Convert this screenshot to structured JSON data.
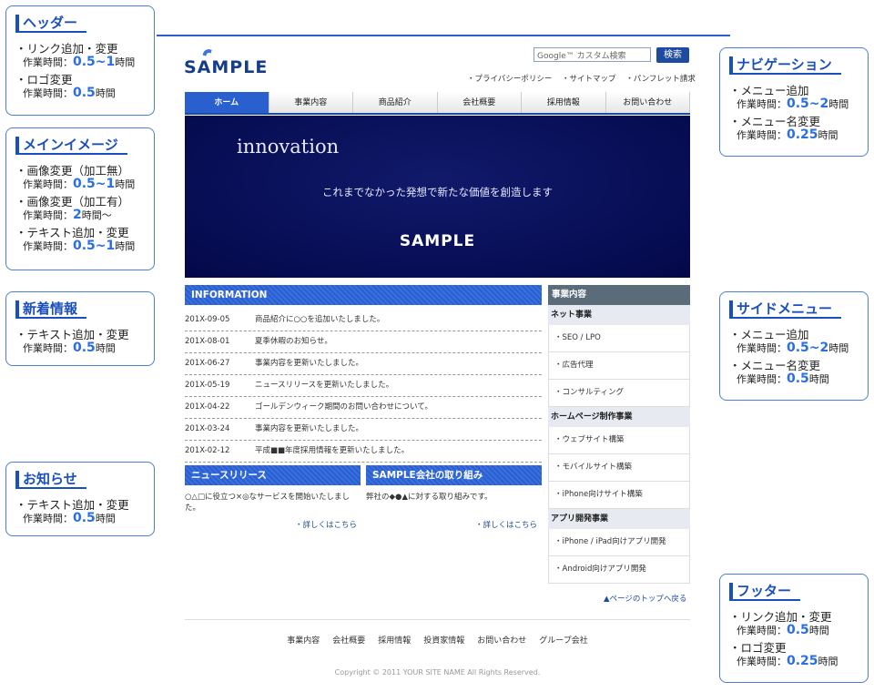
{
  "site": {
    "logo": "SAMPLE",
    "search_placeholder": "Google™ カスタム検索",
    "search_button": "検索",
    "top_links": [
      "・プライバシーポリシー",
      "・サイトマップ",
      "・パンフレット請求"
    ],
    "nav": [
      "ホーム",
      "事業内容",
      "商品紹介",
      "会社概要",
      "採用情報",
      "お問い合わせ"
    ],
    "hero": {
      "title": "innovation",
      "subtitle": "これまでなかった発想で新たな価値を創造します",
      "logo": "SAMPLE"
    },
    "info_title": "INFORMATION",
    "info": [
      {
        "date": "201X-09-05",
        "text": "商品紹介に○○を追加いたしました。"
      },
      {
        "date": "201X-08-01",
        "text": "夏季休暇のお知らせ。"
      },
      {
        "date": "201X-06-27",
        "text": "事業内容を更新いたしました。"
      },
      {
        "date": "201X-05-19",
        "text": "ニュースリリースを更新いたしました。"
      },
      {
        "date": "201X-04-22",
        "text": "ゴールデンウィーク期間のお問い合わせについて。"
      },
      {
        "date": "201X-03-24",
        "text": "事業内容を更新いたしました。"
      },
      {
        "date": "201X-02-12",
        "text": "平成■■年度採用情報を更新いたしました。"
      }
    ],
    "news_title": "ニュースリリース",
    "news_text": "○△□に役立つ×◎なサービスを開始いたしました。",
    "news_more": "・詳しくはこちら",
    "csr_title": "SAMPLE会社の取り組み",
    "csr_text": "弊社の◆●▲に対する取り組みです。",
    "csr_more": "・詳しくはこちら",
    "side_title": "事業内容",
    "side": [
      {
        "cat": "ネット事業",
        "items": [
          "・SEO / LPO",
          "・広告代理",
          "・コンサルティング"
        ]
      },
      {
        "cat": "ホームページ制作事業",
        "items": [
          "・ウェブサイト構築",
          "・モバイルサイト構築",
          "・iPhone向けサイト構築"
        ]
      },
      {
        "cat": "アプリ開発事業",
        "items": [
          "・iPhone / iPad向けアプリ開発",
          "・Android向けアプリ開発"
        ]
      }
    ],
    "page_top": "▲ページのトップへ戻る",
    "footer_links": [
      "事業内容",
      "会社概要",
      "採用情報",
      "投資家情報",
      "お問い合わせ",
      "グループ会社"
    ],
    "copyright": "Copyright © 2011 YOUR SITE NAME All Rights Reserved."
  },
  "callouts": {
    "header": {
      "title": "ヘッダー",
      "items": [
        {
          "label": "・リンク追加・変更",
          "prefix": "作業時間：",
          "value": "0.5~1",
          "suffix": "時間"
        },
        {
          "label": "・ロゴ変更",
          "prefix": "作業時間：",
          "value": "0.5",
          "suffix": "時間"
        }
      ]
    },
    "mainimage": {
      "title": "メインイメージ",
      "items": [
        {
          "label": "・画像変更（加工無）",
          "prefix": "作業時間：",
          "value": "0.5~1",
          "suffix": "時間"
        },
        {
          "label": "・画像変更（加工有）",
          "prefix": "作業時間：",
          "value": "2",
          "suffix": "時間～"
        },
        {
          "label": "・テキスト追加・変更",
          "prefix": "作業時間：",
          "value": "0.5~1",
          "suffix": "時間"
        }
      ]
    },
    "news": {
      "title": "新着情報",
      "items": [
        {
          "label": "・テキスト追加・変更",
          "prefix": "作業時間：",
          "value": "0.5",
          "suffix": "時間"
        }
      ]
    },
    "notice": {
      "title": "お知らせ",
      "items": [
        {
          "label": "・テキスト追加・変更",
          "prefix": "作業時間：",
          "value": "0.5",
          "suffix": "時間"
        }
      ]
    },
    "navigation": {
      "title": "ナビゲーション",
      "items": [
        {
          "label": "・メニュー追加",
          "prefix": "作業時間：",
          "value": "0.5~2",
          "suffix": "時間"
        },
        {
          "label": "・メニュー名変更",
          "prefix": "作業時間：",
          "value": "0.25",
          "suffix": "時間"
        }
      ]
    },
    "sidemenu": {
      "title": "サイドメニュー",
      "items": [
        {
          "label": "・メニュー追加",
          "prefix": "作業時間：",
          "value": "0.5~2",
          "suffix": "時間"
        },
        {
          "label": "・メニュー名変更",
          "prefix": "作業時間：",
          "value": "0.5",
          "suffix": "時間"
        }
      ]
    },
    "footer": {
      "title": "フッター",
      "items": [
        {
          "label": "・リンク追加・変更",
          "prefix": "作業時間：",
          "value": "0.5",
          "suffix": "時間"
        },
        {
          "label": "・ロゴ変更",
          "prefix": "作業時間：",
          "value": "0.25",
          "suffix": "時間"
        }
      ]
    }
  },
  "colors": {
    "accent": "#2a5fd0",
    "brand_dark": "#163d8a",
    "hero_bg": "#04084a",
    "side_head": "#5a6b7a"
  }
}
